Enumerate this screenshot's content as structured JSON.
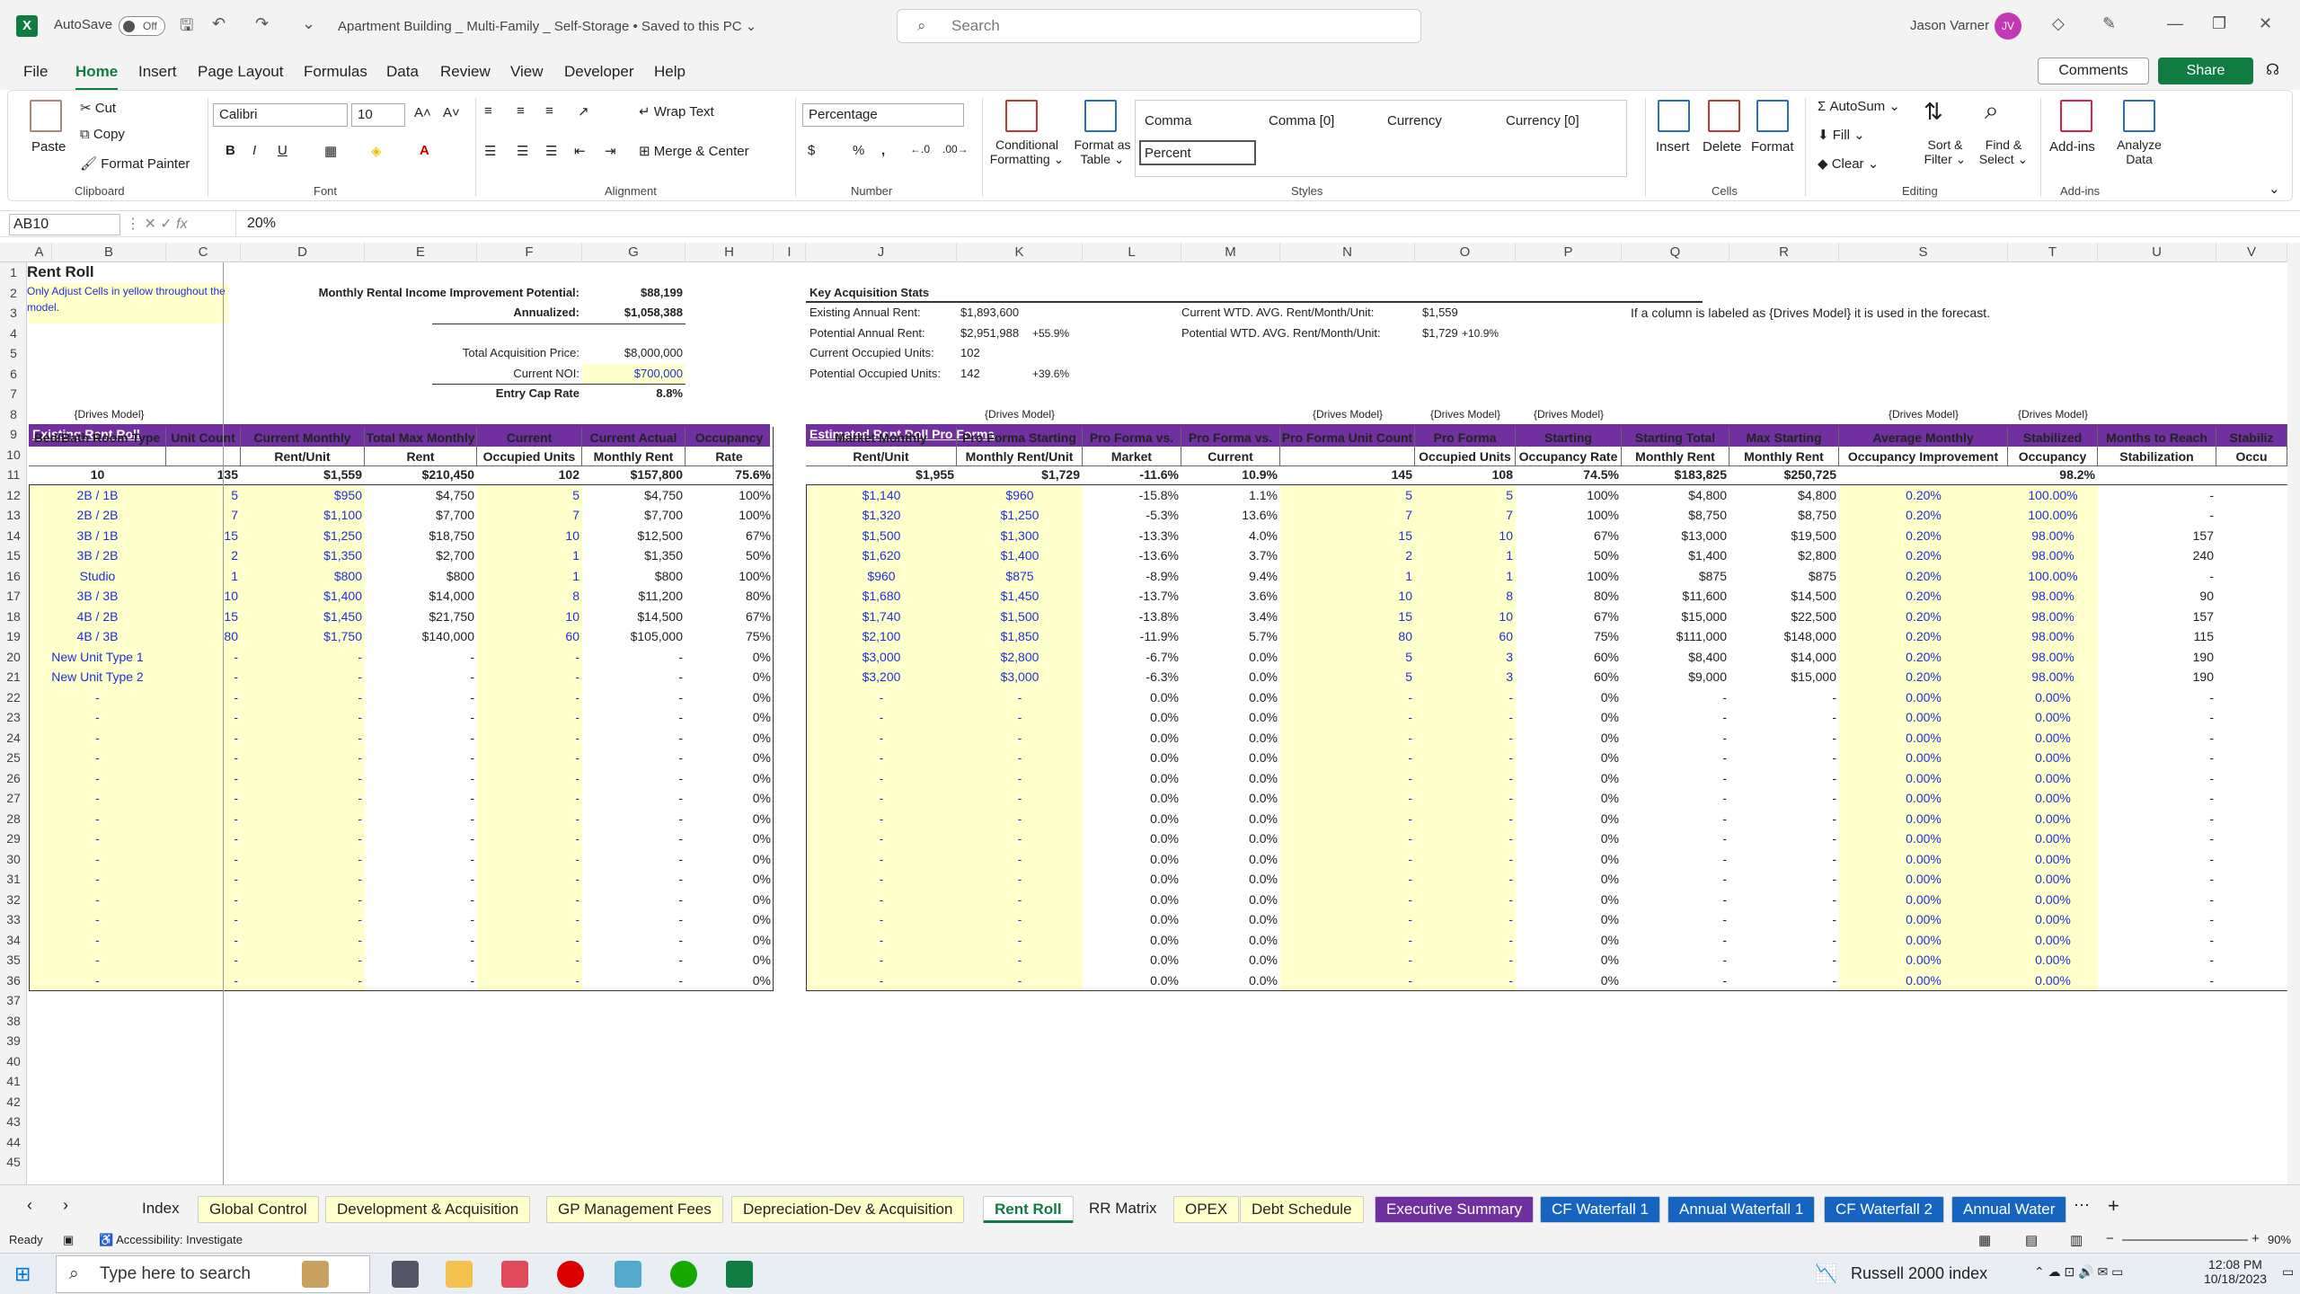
{
  "title": {
    "autosave": "AutoSave",
    "toggle": "Off",
    "doc": "Apartment Building _ Multi-Family _ Self-Storage • Saved to this PC ⌄",
    "search": "Search",
    "user": "Jason Varner",
    "initials": "JV"
  },
  "menu": {
    "tabs": [
      "File",
      "Home",
      "Insert",
      "Page Layout",
      "Formulas",
      "Data",
      "Review",
      "View",
      "Developer",
      "Help"
    ],
    "comments": "Comments",
    "share": "Share"
  },
  "ribbon": {
    "clipboard": {
      "paste": "Paste",
      "cut": "Cut",
      "copy": "Copy",
      "format_painter": "Format Painter",
      "label": "Clipboard"
    },
    "font": {
      "name": "Calibri",
      "size": "10",
      "label": "Font"
    },
    "alignment": {
      "wrap": "Wrap Text",
      "merge": "Merge & Center",
      "label": "Alignment"
    },
    "number": {
      "format": "Percentage",
      "label": "Number"
    },
    "styles": {
      "cond": "Conditional",
      "cond2": "Formatting ⌄",
      "fat": "Format as",
      "fat2": "Table ⌄",
      "cells": [
        "Comma",
        "Comma [0]",
        "Currency",
        "Currency [0]",
        "Percent"
      ],
      "label": "Styles"
    },
    "cells": {
      "insert": "Insert",
      "delete": "Delete",
      "format": "Format",
      "label": "Cells"
    },
    "editing": {
      "autosum": "AutoSum ⌄",
      "fill": "Fill ⌄",
      "clear": "Clear ⌄",
      "sort": "Sort &",
      "sort2": "Filter ⌄",
      "find": "Find &",
      "find2": "Select ⌄",
      "label": "Editing"
    },
    "addins": {
      "addins": "Add-ins",
      "analyze": "Analyze",
      "analyze2": "Data",
      "label": "Add-ins"
    }
  },
  "formula": {
    "namebox": "AB10",
    "fx": "fx",
    "value": "20%"
  },
  "cols": [
    [
      "A",
      30,
      28
    ],
    [
      "B",
      58,
      127
    ],
    [
      "C",
      185,
      83
    ],
    [
      "D",
      268,
      138
    ],
    [
      "E",
      406,
      125
    ],
    [
      "F",
      531,
      117
    ],
    [
      "G",
      648,
      115
    ],
    [
      "H",
      763,
      98
    ],
    [
      "I",
      861,
      36
    ],
    [
      "J",
      897,
      168
    ],
    [
      "K",
      1065,
      140
    ],
    [
      "L",
      1205,
      110
    ],
    [
      "M",
      1315,
      110
    ],
    [
      "N",
      1425,
      150
    ],
    [
      "O",
      1575,
      112
    ],
    [
      "P",
      1687,
      118
    ],
    [
      "Q",
      1805,
      120
    ],
    [
      "R",
      1925,
      122
    ],
    [
      "S",
      2047,
      188
    ],
    [
      "T",
      2235,
      100
    ],
    [
      "U",
      2335,
      132
    ],
    [
      "V",
      2467,
      79
    ]
  ],
  "sheet": {
    "a1": "Rent Roll",
    "note": "Only Adjust Cells in yellow throughout the model.",
    "sum_labels": [
      "Monthly Rental Income Improvement Potential:",
      "Annualized:",
      "Total Acquisition Price:",
      "Current NOI:",
      "Entry Cap Rate"
    ],
    "sum_values": [
      "$88,199",
      "$1,058,388",
      "$8,000,000",
      "$700,000",
      "8.8%"
    ],
    "key_title": "Key Acquisition Stats",
    "key_labels": [
      "Existing Annual Rent:",
      "Potential Annual Rent:",
      "Current Occupied Units:",
      "Potential Occupied Units:"
    ],
    "key_values": [
      "$1,893,600",
      "$2,951,988",
      "102",
      "142"
    ],
    "key_pcts": [
      "",
      "+55.9%",
      "",
      "+39.6%"
    ],
    "wtd_labels": [
      "Current WTD. AVG. Rent/Month/Unit:",
      "Potential WTD. AVG. Rent/Month/Unit:"
    ],
    "wtd_values": [
      "$1,559",
      "$1,729"
    ],
    "wtd_pct": "+10.9%",
    "note_right": "If a column is labeled as {Drives Model} it is used in the forecast.",
    "drives": "{Drives Model}",
    "existing_title": "Existing Rent Roll",
    "proforma_title": "Estimated Rent Roll Pro Forma",
    "hdr_left": [
      "Bed/Bath Room Type",
      "Unit Count",
      "Current Monthly Rent/Unit",
      "Total Max Monthly Rent",
      "Current Occupied Units",
      "Current Actual Monthly Rent",
      "Occupancy Rate"
    ],
    "hdr_right": [
      "Market Monthly Rent/Unit",
      "Pro Forma Starting Monthly Rent/Unit",
      "Pro Forma vs. Market",
      "Pro Forma vs. Current",
      "Pro Forma Unit Count",
      "Pro Forma Occupied Units",
      "Starting Occupancy Rate",
      "Starting Total Monthly Rent",
      "Max Starting Monthly Rent",
      "Average Monthly Occupancy Improvement",
      "Stabilized Occupancy",
      "Months to Reach Stabilization",
      "Stabiliz Occu"
    ],
    "totals_left": [
      "10",
      "135",
      "$1,559",
      "$210,450",
      "102",
      "$157,800",
      "75.6%"
    ],
    "totals_right": [
      "$1,955",
      "$1,729",
      "-11.6%",
      "10.9%",
      "145",
      "108",
      "74.5%",
      "$183,825",
      "$250,725",
      "",
      "98.2%",
      "",
      ""
    ],
    "rows_left": [
      [
        "2B / 1B",
        "5",
        "$950",
        "$4,750",
        "5",
        "$4,750",
        "100%"
      ],
      [
        "2B / 2B",
        "7",
        "$1,100",
        "$7,700",
        "7",
        "$7,700",
        "100%"
      ],
      [
        "3B / 1B",
        "15",
        "$1,250",
        "$18,750",
        "10",
        "$12,500",
        "67%"
      ],
      [
        "3B / 2B",
        "2",
        "$1,350",
        "$2,700",
        "1",
        "$1,350",
        "50%"
      ],
      [
        "Studio",
        "1",
        "$800",
        "$800",
        "1",
        "$800",
        "100%"
      ],
      [
        "3B / 3B",
        "10",
        "$1,400",
        "$14,000",
        "8",
        "$11,200",
        "80%"
      ],
      [
        "4B / 2B",
        "15",
        "$1,450",
        "$21,750",
        "10",
        "$14,500",
        "67%"
      ],
      [
        "4B / 3B",
        "80",
        "$1,750",
        "$140,000",
        "60",
        "$105,000",
        "75%"
      ],
      [
        "New Unit Type 1",
        "-",
        "-",
        "-",
        "-",
        "-",
        "0%"
      ],
      [
        "New Unit Type 2",
        "-",
        "-",
        "-",
        "-",
        "-",
        "0%"
      ]
    ],
    "rows_right": [
      [
        "$1,140",
        "$960",
        "-15.8%",
        "1.1%",
        "5",
        "5",
        "100%",
        "$4,800",
        "$4,800",
        "0.20%",
        "100.00%",
        "-"
      ],
      [
        "$1,320",
        "$1,250",
        "-5.3%",
        "13.6%",
        "7",
        "7",
        "100%",
        "$8,750",
        "$8,750",
        "0.20%",
        "100.00%",
        "-"
      ],
      [
        "$1,500",
        "$1,300",
        "-13.3%",
        "4.0%",
        "15",
        "10",
        "67%",
        "$13,000",
        "$19,500",
        "0.20%",
        "98.00%",
        "157"
      ],
      [
        "$1,620",
        "$1,400",
        "-13.6%",
        "3.7%",
        "2",
        "1",
        "50%",
        "$1,400",
        "$2,800",
        "0.20%",
        "98.00%",
        "240"
      ],
      [
        "$960",
        "$875",
        "-8.9%",
        "9.4%",
        "1",
        "1",
        "100%",
        "$875",
        "$875",
        "0.20%",
        "100.00%",
        "-"
      ],
      [
        "$1,680",
        "$1,450",
        "-13.7%",
        "3.6%",
        "10",
        "8",
        "80%",
        "$11,600",
        "$14,500",
        "0.20%",
        "98.00%",
        "90"
      ],
      [
        "$1,740",
        "$1,500",
        "-13.8%",
        "3.4%",
        "15",
        "10",
        "67%",
        "$15,000",
        "$22,500",
        "0.20%",
        "98.00%",
        "157"
      ],
      [
        "$2,100",
        "$1,850",
        "-11.9%",
        "5.7%",
        "80",
        "60",
        "75%",
        "$111,000",
        "$148,000",
        "0.20%",
        "98.00%",
        "115"
      ],
      [
        "$3,000",
        "$2,800",
        "-6.7%",
        "0.0%",
        "5",
        "3",
        "60%",
        "$8,400",
        "$14,000",
        "0.20%",
        "98.00%",
        "190"
      ],
      [
        "$3,200",
        "$3,000",
        "-6.3%",
        "0.0%",
        "5",
        "3",
        "60%",
        "$9,000",
        "$15,000",
        "0.20%",
        "98.00%",
        "190"
      ]
    ],
    "empty_left": [
      "-",
      "-",
      "-",
      "-",
      "-",
      "-",
      "0%"
    ],
    "empty_right": [
      "-",
      "-",
      "0.0%",
      "0.0%",
      "-",
      "-",
      "0%",
      "-",
      "-",
      "0.00%",
      "0.00%",
      "-"
    ]
  },
  "tabs": [
    "Index",
    "Global Control",
    "Development & Acquisition",
    "GP Management Fees",
    "Depreciation-Dev & Acquisition",
    "Rent Roll",
    "RR Matrix",
    "OPEX",
    "Debt Schedule",
    "Executive Summary",
    "CF Waterfall 1",
    "Annual Waterfall 1",
    "CF Waterfall 2",
    "Annual Water"
  ],
  "status": {
    "ready": "Ready",
    "access": "Accessibility: Investigate",
    "zoom": "90%"
  },
  "taskbar": {
    "search": "Type here to search",
    "ticker": "Russell 2000 index",
    "time": "12:08 PM",
    "date": "10/18/2023"
  }
}
